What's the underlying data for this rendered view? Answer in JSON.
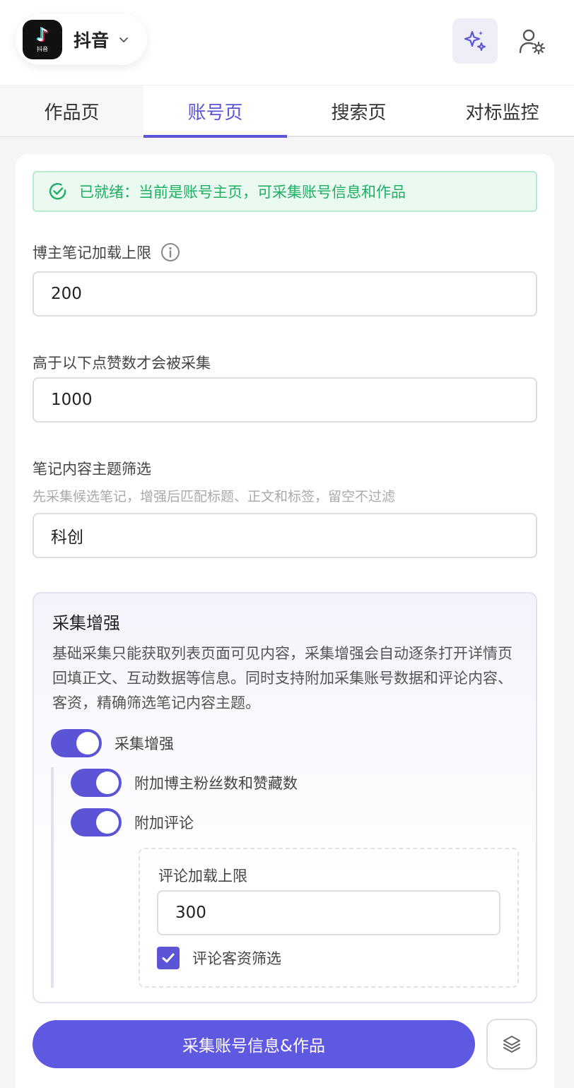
{
  "header": {
    "app_name": "抖音",
    "logo_text": "抖音",
    "logo_glyph": "♪",
    "icons": [
      "tiktok-logo-icon",
      "chevron-down-icon",
      "sparkles-icon",
      "user-settings-icon"
    ]
  },
  "tabs": [
    {
      "label": "作品页",
      "active": false
    },
    {
      "label": "账号页",
      "active": true
    },
    {
      "label": "搜索页",
      "active": false
    },
    {
      "label": "对标监控",
      "active": false
    }
  ],
  "status": {
    "text": "已就绪：当前是账号主页，可采集账号信息和作品",
    "color": "#1fae63"
  },
  "form": {
    "note_limit_label": "博主笔记加载上限",
    "note_limit_value": "200",
    "likes_label": "高于以下点赞数才会被采集",
    "likes_value": "1000",
    "topic_label": "笔记内容主题筛选",
    "topic_hint": "先采集候选笔记，增强后匹配标题、正文和标签，留空不过滤",
    "topic_value": "科创"
  },
  "enhance": {
    "title": "采集增强",
    "description": "基础采集只能获取列表页面可见内容，采集增强会自动逐条打开详情页回填正文、互动数据等信息。同时支持附加采集账号数据和评论内容、客资，精确筛选笔记内容主题。",
    "toggles": [
      {
        "label": "采集增强",
        "on": true
      },
      {
        "label": "附加博主粉丝数和赞藏数",
        "on": true
      },
      {
        "label": "附加评论",
        "on": true
      }
    ],
    "comment_limit_label": "评论加载上限",
    "comment_limit_value": "300",
    "lead_filter_label": "评论客资筛选",
    "lead_filter_checked": true
  },
  "actions": {
    "primary_label": "采集账号信息&作品",
    "secondary_icon": "layers-icon"
  },
  "colors": {
    "accent": "#5b54d6",
    "success": "#1fae63"
  }
}
